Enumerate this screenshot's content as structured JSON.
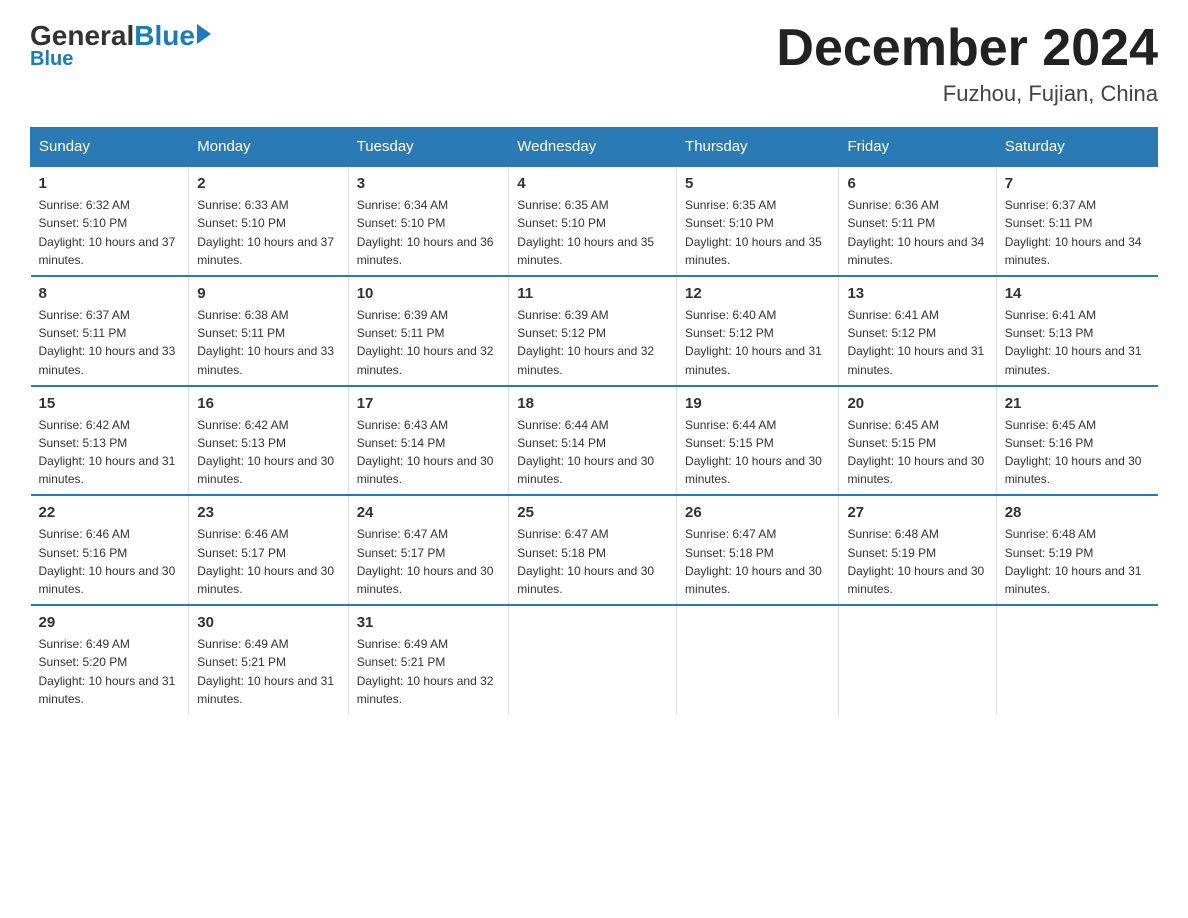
{
  "logo": {
    "general": "General",
    "blue": "Blue",
    "subtitle": "Blue"
  },
  "header": {
    "title": "December 2024",
    "subtitle": "Fuzhou, Fujian, China"
  },
  "columns": [
    "Sunday",
    "Monday",
    "Tuesday",
    "Wednesday",
    "Thursday",
    "Friday",
    "Saturday"
  ],
  "weeks": [
    [
      {
        "day": "1",
        "sunrise": "6:32 AM",
        "sunset": "5:10 PM",
        "daylight": "10 hours and 37 minutes."
      },
      {
        "day": "2",
        "sunrise": "6:33 AM",
        "sunset": "5:10 PM",
        "daylight": "10 hours and 37 minutes."
      },
      {
        "day": "3",
        "sunrise": "6:34 AM",
        "sunset": "5:10 PM",
        "daylight": "10 hours and 36 minutes."
      },
      {
        "day": "4",
        "sunrise": "6:35 AM",
        "sunset": "5:10 PM",
        "daylight": "10 hours and 35 minutes."
      },
      {
        "day": "5",
        "sunrise": "6:35 AM",
        "sunset": "5:10 PM",
        "daylight": "10 hours and 35 minutes."
      },
      {
        "day": "6",
        "sunrise": "6:36 AM",
        "sunset": "5:11 PM",
        "daylight": "10 hours and 34 minutes."
      },
      {
        "day": "7",
        "sunrise": "6:37 AM",
        "sunset": "5:11 PM",
        "daylight": "10 hours and 34 minutes."
      }
    ],
    [
      {
        "day": "8",
        "sunrise": "6:37 AM",
        "sunset": "5:11 PM",
        "daylight": "10 hours and 33 minutes."
      },
      {
        "day": "9",
        "sunrise": "6:38 AM",
        "sunset": "5:11 PM",
        "daylight": "10 hours and 33 minutes."
      },
      {
        "day": "10",
        "sunrise": "6:39 AM",
        "sunset": "5:11 PM",
        "daylight": "10 hours and 32 minutes."
      },
      {
        "day": "11",
        "sunrise": "6:39 AM",
        "sunset": "5:12 PM",
        "daylight": "10 hours and 32 minutes."
      },
      {
        "day": "12",
        "sunrise": "6:40 AM",
        "sunset": "5:12 PM",
        "daylight": "10 hours and 31 minutes."
      },
      {
        "day": "13",
        "sunrise": "6:41 AM",
        "sunset": "5:12 PM",
        "daylight": "10 hours and 31 minutes."
      },
      {
        "day": "14",
        "sunrise": "6:41 AM",
        "sunset": "5:13 PM",
        "daylight": "10 hours and 31 minutes."
      }
    ],
    [
      {
        "day": "15",
        "sunrise": "6:42 AM",
        "sunset": "5:13 PM",
        "daylight": "10 hours and 31 minutes."
      },
      {
        "day": "16",
        "sunrise": "6:42 AM",
        "sunset": "5:13 PM",
        "daylight": "10 hours and 30 minutes."
      },
      {
        "day": "17",
        "sunrise": "6:43 AM",
        "sunset": "5:14 PM",
        "daylight": "10 hours and 30 minutes."
      },
      {
        "day": "18",
        "sunrise": "6:44 AM",
        "sunset": "5:14 PM",
        "daylight": "10 hours and 30 minutes."
      },
      {
        "day": "19",
        "sunrise": "6:44 AM",
        "sunset": "5:15 PM",
        "daylight": "10 hours and 30 minutes."
      },
      {
        "day": "20",
        "sunrise": "6:45 AM",
        "sunset": "5:15 PM",
        "daylight": "10 hours and 30 minutes."
      },
      {
        "day": "21",
        "sunrise": "6:45 AM",
        "sunset": "5:16 PM",
        "daylight": "10 hours and 30 minutes."
      }
    ],
    [
      {
        "day": "22",
        "sunrise": "6:46 AM",
        "sunset": "5:16 PM",
        "daylight": "10 hours and 30 minutes."
      },
      {
        "day": "23",
        "sunrise": "6:46 AM",
        "sunset": "5:17 PM",
        "daylight": "10 hours and 30 minutes."
      },
      {
        "day": "24",
        "sunrise": "6:47 AM",
        "sunset": "5:17 PM",
        "daylight": "10 hours and 30 minutes."
      },
      {
        "day": "25",
        "sunrise": "6:47 AM",
        "sunset": "5:18 PM",
        "daylight": "10 hours and 30 minutes."
      },
      {
        "day": "26",
        "sunrise": "6:47 AM",
        "sunset": "5:18 PM",
        "daylight": "10 hours and 30 minutes."
      },
      {
        "day": "27",
        "sunrise": "6:48 AM",
        "sunset": "5:19 PM",
        "daylight": "10 hours and 30 minutes."
      },
      {
        "day": "28",
        "sunrise": "6:48 AM",
        "sunset": "5:19 PM",
        "daylight": "10 hours and 31 minutes."
      }
    ],
    [
      {
        "day": "29",
        "sunrise": "6:49 AM",
        "sunset": "5:20 PM",
        "daylight": "10 hours and 31 minutes."
      },
      {
        "day": "30",
        "sunrise": "6:49 AM",
        "sunset": "5:21 PM",
        "daylight": "10 hours and 31 minutes."
      },
      {
        "day": "31",
        "sunrise": "6:49 AM",
        "sunset": "5:21 PM",
        "daylight": "10 hours and 32 minutes."
      },
      null,
      null,
      null,
      null
    ]
  ]
}
